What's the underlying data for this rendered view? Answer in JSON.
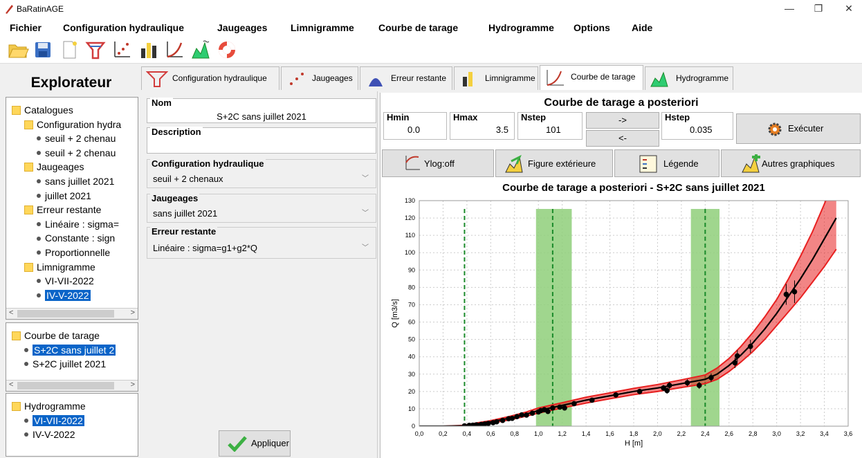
{
  "window": {
    "title": "BaRatinAGE",
    "minimize": "—",
    "maximize": "❐",
    "close": "✕"
  },
  "menu": [
    "Fichier",
    "Configuration hydraulique",
    "Jaugeages",
    "Limnigramme",
    "Courbe de tarage",
    "Hydrogramme",
    "Options",
    "Aide"
  ],
  "explorer": {
    "title": "Explorateur",
    "tree1": [
      {
        "label": "Catalogues",
        "type": "folder",
        "level": 0
      },
      {
        "label": "Configuration hydra",
        "type": "folder",
        "level": 1
      },
      {
        "label": "seuil + 2 chenau",
        "type": "item",
        "level": 2
      },
      {
        "label": "seuil + 2 chenau",
        "type": "item",
        "level": 2
      },
      {
        "label": "Jaugeages",
        "type": "folder",
        "level": 1
      },
      {
        "label": "sans juillet 2021",
        "type": "item",
        "level": 2
      },
      {
        "label": "juillet 2021",
        "type": "item",
        "level": 2
      },
      {
        "label": "Erreur restante",
        "type": "folder",
        "level": 1
      },
      {
        "label": "Linéaire : sigma=",
        "type": "item",
        "level": 2
      },
      {
        "label": "Constante : sign",
        "type": "item",
        "level": 2
      },
      {
        "label": "Proportionnelle",
        "type": "item",
        "level": 2
      },
      {
        "label": "Limnigramme",
        "type": "folder",
        "level": 1
      },
      {
        "label": "VI-VII-2022",
        "type": "item",
        "level": 2
      },
      {
        "label": "IV-V-2022",
        "type": "item",
        "level": 2,
        "selected": true
      }
    ],
    "tree2": [
      {
        "label": "Courbe de tarage",
        "type": "folder",
        "level": 0
      },
      {
        "label": "S+2C sans juillet 2",
        "type": "item",
        "level": 1,
        "selected": true
      },
      {
        "label": "S+2C juillet 2021",
        "type": "item",
        "level": 1
      }
    ],
    "tree3": [
      {
        "label": "Hydrogramme",
        "type": "folder",
        "level": 0
      },
      {
        "label": "VI-VII-2022",
        "type": "item",
        "level": 1,
        "selected": true
      },
      {
        "label": "IV-V-2022",
        "type": "item",
        "level": 1
      }
    ]
  },
  "tabs": [
    "Configuration hydraulique",
    "Jaugeages",
    "Erreur restante",
    "Limnigramme",
    "Courbe de tarage",
    "Hydrogramme"
  ],
  "form": {
    "nom_label": "Nom",
    "nom_value": "S+2C sans juillet 2021",
    "description_label": "Description",
    "config_label": "Configuration hydraulique",
    "config_value": "seuil + 2 chenaux",
    "jaug_label": "Jaugeages",
    "jaug_value": "sans juillet 2021",
    "err_label": "Erreur restante",
    "err_value": "Linéaire : sigma=g1+g2*Q",
    "apply": "Appliquer"
  },
  "panel": {
    "title": "Courbe de tarage a posteriori",
    "hmin_label": "Hmin",
    "hmin": "0.0",
    "hmax_label": "Hmax",
    "hmax": "3.5",
    "nstep_label": "Nstep",
    "nstep": "101",
    "hstep_label": "Hstep",
    "hstep": "0.035",
    "arrow_right": "->",
    "arrow_left": "<-",
    "run": "Exécuter",
    "ylog": "Ylog:off",
    "fig_ext": "Figure extérieure",
    "legende": "Légende",
    "autres": "Autres graphiques"
  },
  "colors": {
    "selection": "#0a64c8",
    "band": "#e82020",
    "green_zone": "#8fcf7a",
    "green_line": "#1a8a2a"
  },
  "chart_data": {
    "type": "line",
    "title": "Courbe de tarage a posteriori - S+2C sans juillet 2021",
    "xlabel": "H [m]",
    "ylabel": "Q [m3/s]",
    "xlim": [
      0,
      3.6
    ],
    "ylim": [
      0,
      130
    ],
    "xticks": [
      "0,0",
      "0,2",
      "0,4",
      "0,6",
      "0,8",
      "1,0",
      "1,2",
      "1,4",
      "1,6",
      "1,8",
      "2,0",
      "2,2",
      "2,4",
      "2,6",
      "2,8",
      "3,0",
      "3,2",
      "3,4",
      "3,6"
    ],
    "yticks": [
      "0",
      "10",
      "20",
      "30",
      "40",
      "50",
      "60",
      "70",
      "80",
      "90",
      "100",
      "110",
      "120",
      "130"
    ],
    "grid": true,
    "green_lines_x": [
      0.38,
      1.12,
      2.4
    ],
    "green_zones": [
      [
        0.98,
        1.28
      ],
      [
        2.28,
        2.52
      ]
    ],
    "curve": {
      "x": [
        0,
        0.2,
        0.38,
        0.45,
        0.6,
        0.75,
        0.9,
        1.0,
        1.1,
        1.2,
        1.4,
        1.6,
        1.8,
        2.0,
        2.2,
        2.4,
        2.5,
        2.6,
        2.7,
        2.8,
        2.9,
        3.0,
        3.1,
        3.2,
        3.3,
        3.4,
        3.5
      ],
      "y": [
        0,
        0,
        0.2,
        1,
        2.5,
        4.5,
        7,
        9,
        10.5,
        12,
        15,
        17.5,
        20,
        22,
        24.5,
        27,
        30,
        35,
        41,
        48,
        56,
        65,
        75,
        85,
        96,
        108,
        120
      ]
    },
    "band": {
      "x": [
        0,
        0.2,
        0.38,
        0.45,
        0.6,
        0.75,
        0.9,
        1.0,
        1.1,
        1.2,
        1.4,
        1.6,
        1.8,
        2.0,
        2.2,
        2.4,
        2.5,
        2.6,
        2.7,
        2.8,
        2.9,
        3.0,
        3.1,
        3.2,
        3.3,
        3.4,
        3.5
      ],
      "lower": [
        0,
        0,
        0,
        0.5,
        1.8,
        3.5,
        5.8,
        7.5,
        9,
        10.5,
        13.3,
        15.8,
        18.2,
        20,
        22.3,
        24.5,
        27,
        31.5,
        37,
        43,
        50,
        58,
        66,
        74,
        83,
        92,
        102
      ],
      "upper": [
        0,
        0,
        0.5,
        1.5,
        3.2,
        5.5,
        8.2,
        10.5,
        12,
        13.5,
        16.7,
        19.2,
        21.8,
        24,
        26.7,
        29.5,
        33.5,
        39,
        46,
        54,
        63,
        73,
        85,
        98,
        112,
        128,
        145
      ]
    },
    "gaugings": {
      "x": [
        0.38,
        0.42,
        0.45,
        0.48,
        0.52,
        0.55,
        0.58,
        0.62,
        0.65,
        0.7,
        0.75,
        0.78,
        0.82,
        0.86,
        0.9,
        0.95,
        1.0,
        1.02,
        1.05,
        1.08,
        1.12,
        1.18,
        1.22,
        1.3,
        1.45,
        1.65,
        1.85,
        2.05,
        2.08,
        2.1,
        2.25,
        2.35,
        2.45,
        2.65,
        2.67,
        2.78,
        3.08,
        3.15
      ],
      "y": [
        0.2,
        0.5,
        0.6,
        0.8,
        1,
        1.3,
        1.6,
        2,
        2.5,
        3.3,
        4.3,
        4.5,
        5.5,
        6.5,
        6.4,
        7.5,
        8.2,
        9,
        9.5,
        8.5,
        10.5,
        11,
        10.5,
        13,
        15,
        18,
        20,
        22,
        20.5,
        23.5,
        25,
        23.5,
        28,
        36.5,
        40.5,
        46,
        76,
        77.5
      ],
      "err": [
        0.2,
        0.3,
        0.3,
        0.3,
        0.3,
        0.4,
        0.4,
        0.4,
        0.5,
        0.5,
        0.6,
        0.6,
        0.7,
        0.7,
        0.7,
        0.8,
        0.9,
        0.9,
        0.9,
        0.9,
        1,
        1,
        1,
        1.2,
        1.3,
        1.5,
        1.6,
        1.8,
        1.8,
        2,
        2,
        2,
        2.4,
        3,
        3.3,
        3.8,
        6,
        6.5
      ]
    }
  }
}
